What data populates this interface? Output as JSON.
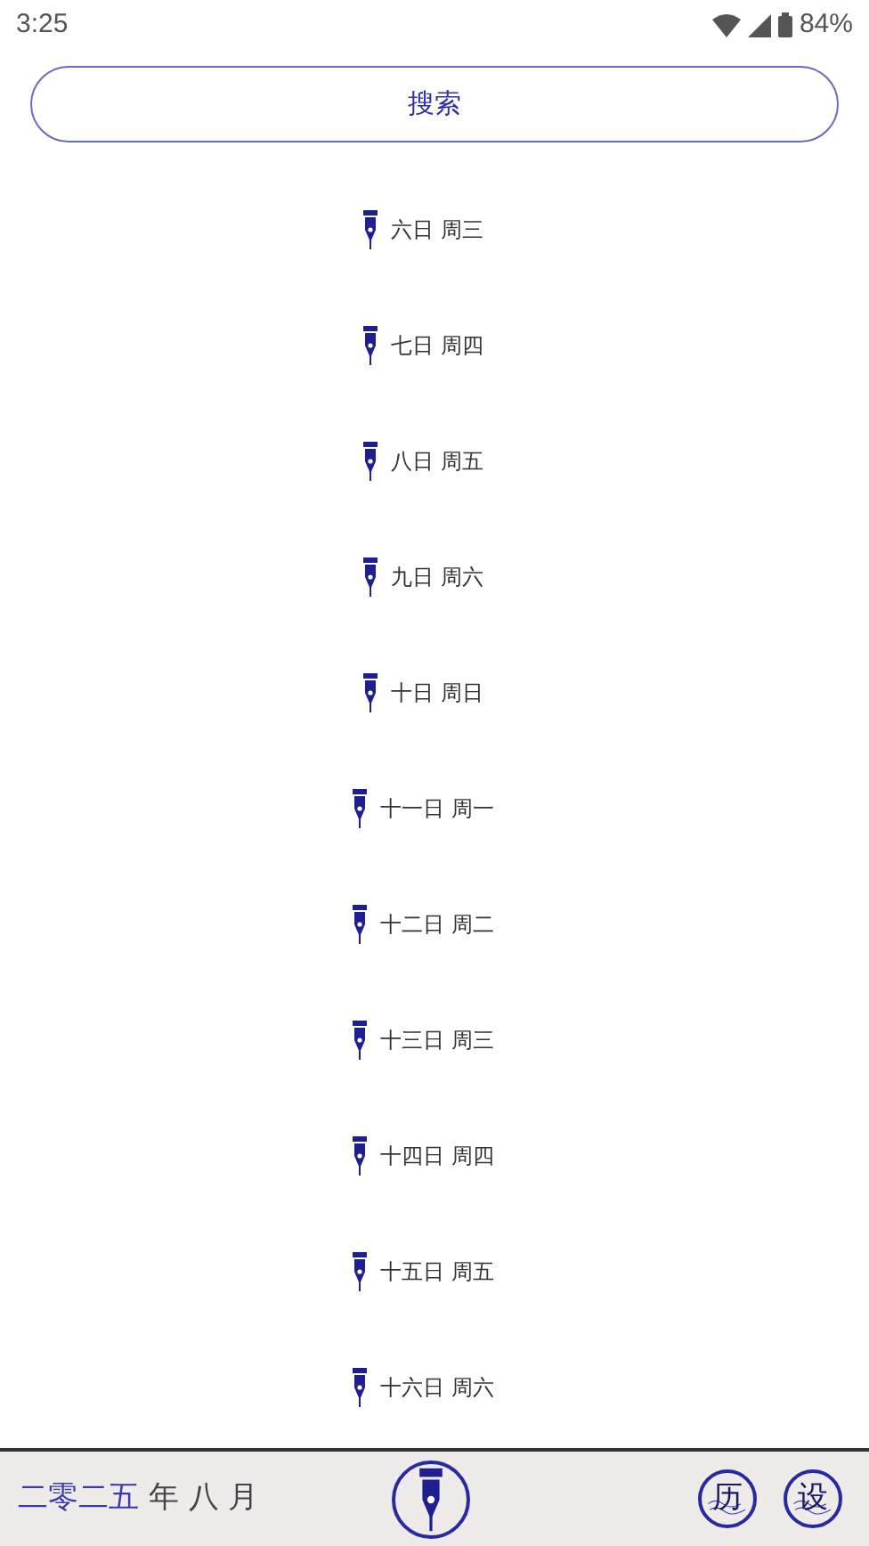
{
  "status_bar": {
    "time": "3:25",
    "battery": "84%"
  },
  "search_button": {
    "label": "搜索"
  },
  "days": [
    {
      "label": "六日 周三"
    },
    {
      "label": "七日 周四"
    },
    {
      "label": "八日 周五"
    },
    {
      "label": "九日 周六"
    },
    {
      "label": "十日 周日"
    },
    {
      "label": "十一日 周一"
    },
    {
      "label": "十二日 周二"
    },
    {
      "label": "十三日 周三"
    },
    {
      "label": "十四日 周四"
    },
    {
      "label": "十五日 周五"
    },
    {
      "label": "十六日 周六"
    }
  ],
  "bottom_bar": {
    "year": "二零二五",
    "month": "年 八 月",
    "buttons": [
      "历",
      "设"
    ]
  }
}
